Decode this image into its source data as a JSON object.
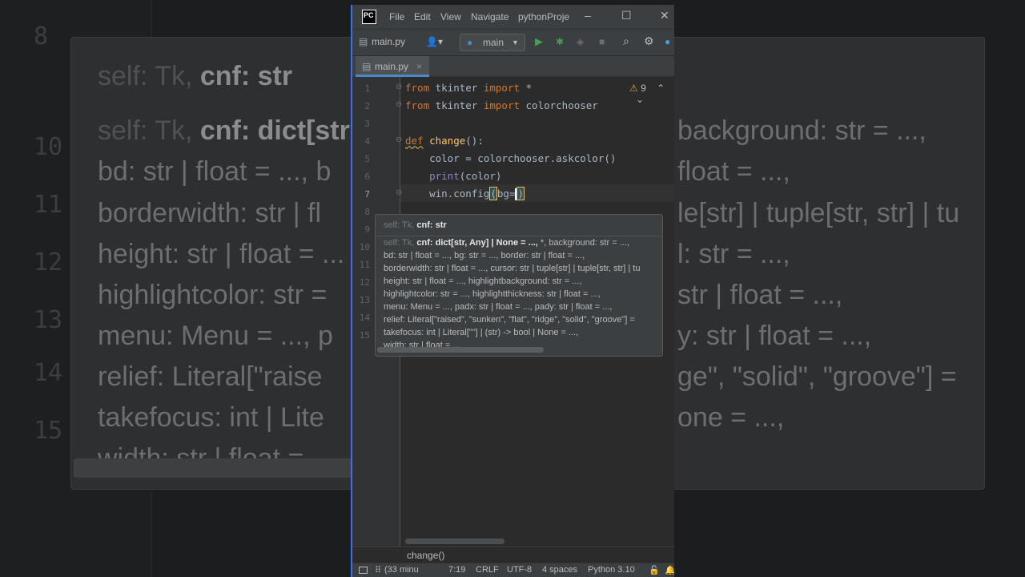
{
  "background": {
    "line_numbers": [
      "8",
      "10",
      "11",
      "12",
      "13",
      "14",
      "15"
    ],
    "popup_first": {
      "dim": "self: Tk,",
      "bold": "cnf: str"
    },
    "popup_lines": [
      {
        "dim": "self: Tk,",
        "bold": "cnf: dict[str",
        "rest": "background: str = ...,"
      },
      {
        "text": "bd: str | float = ..., b",
        "rest": "float = ...,"
      },
      {
        "text": "borderwidth: str | fl",
        "rest": "le[str] | tuple[str, str] | tu"
      },
      {
        "text": "height: str | float = ...",
        "rest": "l: str = ...,"
      },
      {
        "text": "highlightcolor: str =",
        "rest": "str | float = ...,"
      },
      {
        "text": "menu: Menu = ..., p",
        "rest": "y: str | float = ...,"
      },
      {
        "text": "relief: Literal[\"raise",
        "rest": "ge\", \"solid\", \"groove\"] ="
      },
      {
        "text": "takefocus: int | Lite",
        "rest": "one = ...,"
      },
      {
        "text": "width: str | float = ..."
      }
    ]
  },
  "titlebar": {
    "logo": "PC",
    "menus": [
      "File",
      "Edit",
      "View",
      "Navigate"
    ],
    "project": "pythonProje",
    "minimize": "–",
    "maximize": "☐",
    "close": "✕"
  },
  "toolbar": {
    "file_label": "main.py",
    "run_config": "main"
  },
  "tabs": [
    {
      "label": "main.py",
      "close": "×"
    }
  ],
  "editor": {
    "warnings_count": "9",
    "lines": [
      "1",
      "2",
      "3",
      "4",
      "5",
      "6",
      "7",
      "8",
      "9",
      "10",
      "11",
      "12",
      "13",
      "14",
      "15"
    ],
    "code": {
      "l1_from": "from",
      "l1_mod": " tkinter ",
      "l1_import": "import",
      "l1_rest": " *",
      "l2_from": "from",
      "l2_mod": " tkinter ",
      "l2_import": "import",
      "l2_rest": " colorchooser",
      "l4_def": "def",
      "l4_name": "change",
      "l4_rest": "():",
      "l5": "    color = colorchooser.askcolor()",
      "l6_indent": "    ",
      "l6_print": "print",
      "l6_rest": "(color)",
      "l7_a": "    win.config",
      "l7_paren": "(",
      "l7_b": "bg=",
      "l7_close": ")"
    }
  },
  "popup": {
    "first": {
      "dim": "self: Tk,",
      "bold": "cnf: str"
    },
    "lines": [
      {
        "dim": "self: Tk,",
        "bold": "cnf: dict[str, Any] | None = ...,",
        "rest": " *, background: str = ...,"
      },
      {
        "text": "bd: str | float = ..., bg: str = ..., border: str | float = ...,"
      },
      {
        "text": "borderwidth: str | float = ..., cursor: str | tuple[str] | tuple[str, str] | tu"
      },
      {
        "text": "height: str | float = ..., highlightbackground: str = ...,"
      },
      {
        "text": "highlightcolor: str = ..., highlightthickness: str | float = ...,"
      },
      {
        "text": "menu: Menu = ..., padx: str | float = ..., pady: str | float = ...,"
      },
      {
        "text": "relief: Literal[\"raised\", \"sunken\", \"flat\", \"ridge\", \"solid\", \"groove\"] ="
      },
      {
        "text": "takefocus: int | Literal[\"\"] | (str) -> bool | None = ...,"
      },
      {
        "text": "width: str | float = ..."
      }
    ]
  },
  "breadcrumb": "change()",
  "statusbar": {
    "events": "(33 minu",
    "position": "7:19",
    "line_sep": "CRLF",
    "encoding": "UTF-8",
    "indent": "4 spaces",
    "interpreter": "Python 3.10"
  },
  "colors": {
    "accent": "#3574f0",
    "keyword": "#cc7832",
    "function": "#ffc66d",
    "builtin": "#8888c6"
  }
}
